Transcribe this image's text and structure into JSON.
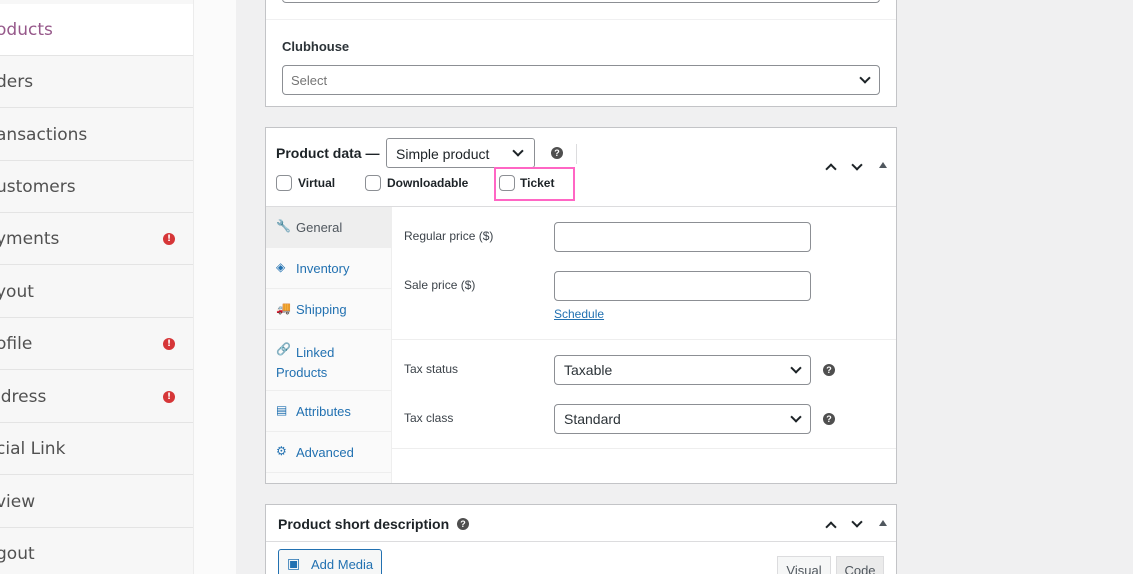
{
  "sidebar": {
    "items": [
      {
        "label": "oducts",
        "active": true,
        "alert": false
      },
      {
        "label": "ders",
        "active": false,
        "alert": false
      },
      {
        "label": "ansactions",
        "active": false,
        "alert": false
      },
      {
        "label": "ustomers",
        "active": false,
        "alert": false
      },
      {
        "label": "yments",
        "active": false,
        "alert": true
      },
      {
        "label": "yout",
        "active": false,
        "alert": false
      },
      {
        "label": "ofile",
        "active": false,
        "alert": true
      },
      {
        "label": "ldress",
        "active": false,
        "alert": true
      },
      {
        "label": "cial Link",
        "active": false,
        "alert": false
      },
      {
        "label": "view",
        "active": false,
        "alert": false
      },
      {
        "label": "gout",
        "active": false,
        "alert": false
      }
    ],
    "alert_icon": "!"
  },
  "clubhouse": {
    "label": "Clubhouse",
    "placeholder": "Select"
  },
  "product_data": {
    "title": "Product data —",
    "type_value": "Simple product",
    "help_glyph": "?",
    "checkboxes": {
      "virtual": "Virtual",
      "downloadable": "Downloadable",
      "ticket": "Ticket"
    },
    "tabs": [
      {
        "label": "General",
        "icon": "wrench-icon",
        "glyph": "🔧"
      },
      {
        "label": "Inventory",
        "icon": "tag-icon",
        "glyph": "◈"
      },
      {
        "label": "Shipping",
        "icon": "truck-icon",
        "glyph": "🚚"
      },
      {
        "label": "Linked Products",
        "icon": "link-icon",
        "glyph": "🔗"
      },
      {
        "label": "Attributes",
        "icon": "list-icon",
        "glyph": "▤"
      },
      {
        "label": "Advanced",
        "icon": "gear-icon",
        "glyph": "⚙"
      }
    ],
    "general": {
      "regular_price_label": "Regular price ($)",
      "sale_price_label": "Sale price ($)",
      "schedule_link": "Schedule",
      "tax_status_label": "Tax status",
      "tax_status_value": "Taxable",
      "tax_class_label": "Tax class",
      "tax_class_value": "Standard"
    }
  },
  "short_description": {
    "title": "Product short description",
    "add_media": "Add Media",
    "visual_tab": "Visual",
    "code_tab": "Code"
  },
  "colors": {
    "accent": "#96588a",
    "link": "#2271b1",
    "highlight": "#ff66c4",
    "alert": "#d63638"
  }
}
